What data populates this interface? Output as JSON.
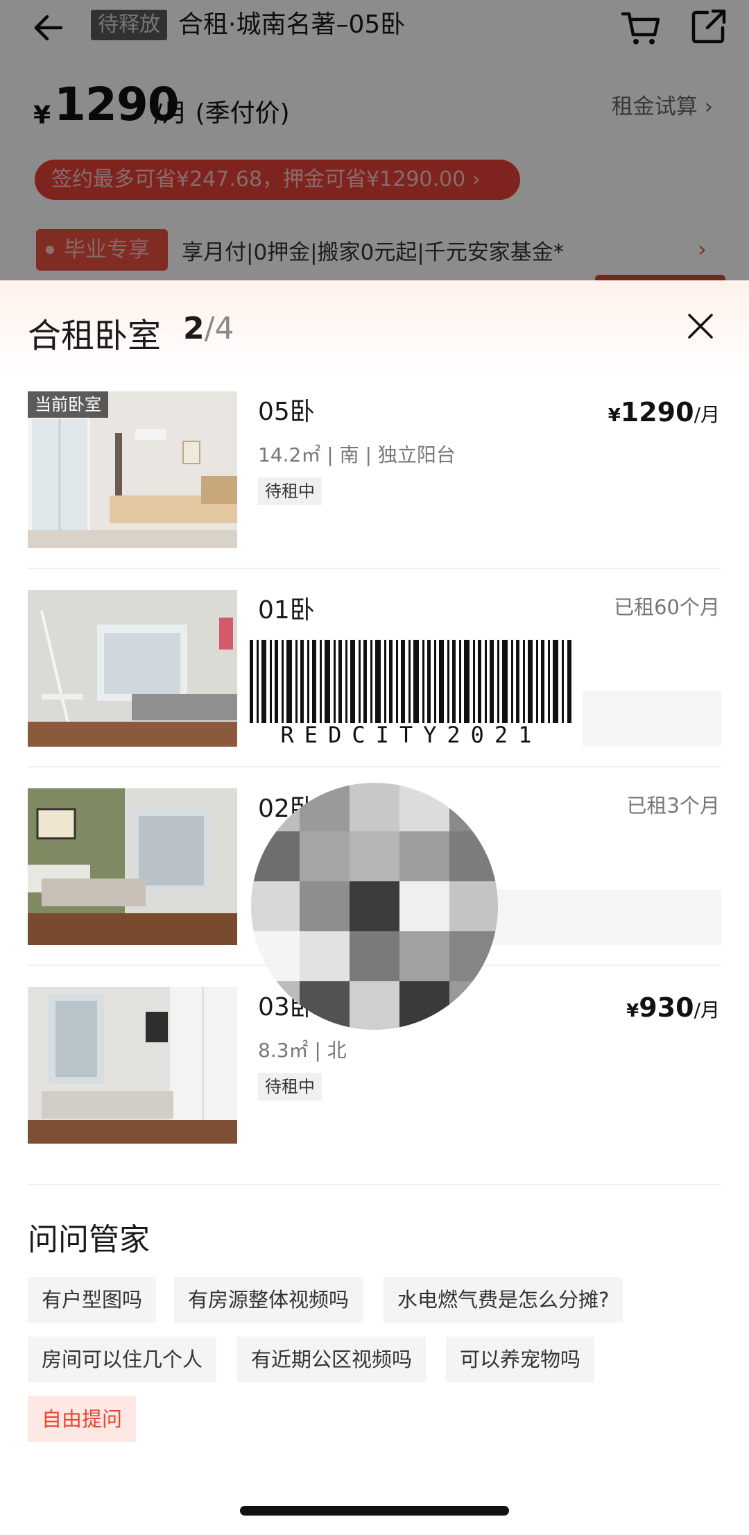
{
  "header": {
    "status_tag": "待释放",
    "title": "合租·城南名著–05卧"
  },
  "price": {
    "currency": "¥",
    "amount": "1290",
    "unit": "/月 (季付价)",
    "calc_link": "租金试算 ›"
  },
  "promo": {
    "save_pill": "签约最多可省¥247.68，押金可省¥1290.00 ›",
    "graduate_tag": "毕业专享",
    "graduate_text": "享月付|0押金|搬家0元起|千元安家基金*",
    "arrow": "›"
  },
  "sheet": {
    "title": "合租卧室",
    "current_index": "2",
    "total": "/4",
    "rooms": [
      {
        "badge": "当前卧室",
        "name": "05卧",
        "meta": "14.2㎡ | 南 | 独立阳台",
        "status": "待租中",
        "price_currency": "¥",
        "price_amount": "1290",
        "price_unit": "/月"
      },
      {
        "name": "01卧",
        "rented": "已租60个月"
      },
      {
        "name": "02卧",
        "rented": "已租3个月"
      },
      {
        "name": "03卧",
        "meta": "8.3㎡ | 北",
        "status": "待租中",
        "price_currency": "¥",
        "price_amount": "930",
        "price_unit": "/月"
      }
    ]
  },
  "barcode": {
    "text": "REDCITY2021"
  },
  "ask": {
    "title": "问问管家",
    "chips": [
      "有户型图吗",
      "有房源整体视频吗",
      "水电燃气费是怎么分摊?",
      "房间可以住几个人",
      "有近期公区视频吗",
      "可以养宠物吗"
    ],
    "free_ask": "自由提问"
  },
  "colors": {
    "accent": "#e8452f",
    "promo_red": "#e8413a",
    "chip_bg": "#f4f4f4"
  }
}
